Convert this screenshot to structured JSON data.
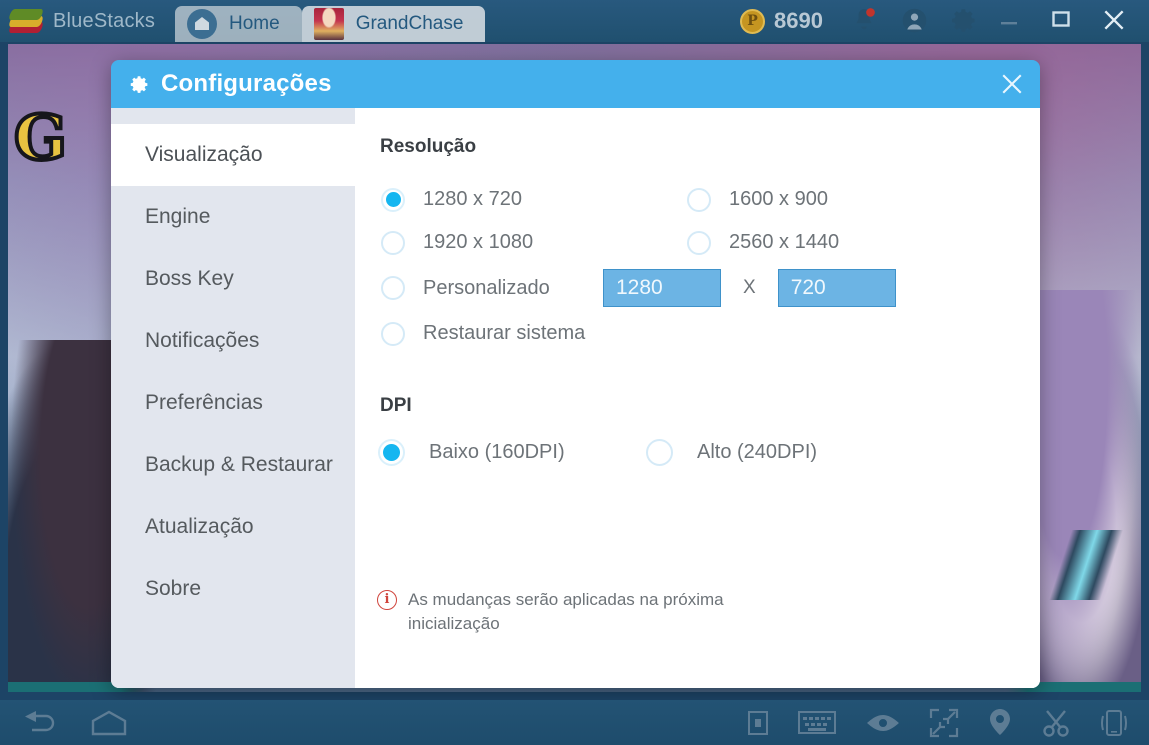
{
  "topbar": {
    "brand_name": "BlueStacks",
    "brand_logo_icon": "bluestacks-layers-icon",
    "tabs": [
      {
        "label": "Home",
        "icon": "home-icon",
        "active": false
      },
      {
        "label": "GrandChase",
        "icon": "grandchase-app-icon",
        "active": true
      }
    ],
    "points": {
      "value": "8690",
      "coin_symbol": "P",
      "icon": "coin-icon"
    },
    "icons": [
      {
        "name": "notifications-bell-icon",
        "badge": true
      },
      {
        "name": "user-account-icon"
      },
      {
        "name": "settings-gear-icon"
      }
    ],
    "window_controls": [
      {
        "name": "minimize-button",
        "glyph": "—"
      },
      {
        "name": "maximize-button",
        "glyph": "▢"
      },
      {
        "name": "close-button",
        "glyph": "✕"
      }
    ]
  },
  "background": {
    "game_logo_text": "G",
    "art_description": "GrandChase key art"
  },
  "dialog": {
    "title": "Configurações",
    "title_icon": "gear-icon",
    "close_icon": "close-icon",
    "accent_color": "#44b0ec",
    "sidebar": {
      "items": [
        {
          "label": "Visualização",
          "active": true
        },
        {
          "label": "Engine",
          "active": false
        },
        {
          "label": "Boss Key",
          "active": false
        },
        {
          "label": "Notificações",
          "active": false
        },
        {
          "label": "Preferências",
          "active": false
        },
        {
          "label": "Backup & Restaurar",
          "active": false
        },
        {
          "label": "Atualização",
          "active": false
        },
        {
          "label": "Sobre",
          "active": false
        }
      ]
    },
    "resolution": {
      "section_title": "Resolução",
      "options": [
        {
          "label": "1280 x 720",
          "selected": true
        },
        {
          "label": "1600 x 900",
          "selected": false
        },
        {
          "label": "1920 x 1080",
          "selected": false
        },
        {
          "label": "2560 x 1440",
          "selected": false
        },
        {
          "label": "Personalizado",
          "selected": false
        },
        {
          "label": "Restaurar sistema",
          "selected": false
        }
      ],
      "custom_width": "1280",
      "custom_height": "720",
      "custom_separator": "X"
    },
    "dpi": {
      "section_title": "DPI",
      "options": [
        {
          "label": "Baixo (160DPI)",
          "selected": true
        },
        {
          "label": "Alto (240DPI)",
          "selected": false
        }
      ]
    },
    "note": {
      "icon": "info-icon",
      "text": "As mudanças serão aplicadas na próxima inicialização",
      "icon_glyph": "i",
      "color": "#d0443c"
    }
  },
  "bottombar": {
    "left_icons": [
      {
        "name": "back-icon"
      },
      {
        "name": "home-icon"
      }
    ],
    "right_icons": [
      {
        "name": "multi-instance-icon"
      },
      {
        "name": "keyboard-controls-icon"
      },
      {
        "name": "eye-icon"
      },
      {
        "name": "fullscreen-icon"
      },
      {
        "name": "location-pin-icon"
      },
      {
        "name": "scissors-screenshot-icon"
      },
      {
        "name": "shake-phone-icon"
      }
    ]
  }
}
